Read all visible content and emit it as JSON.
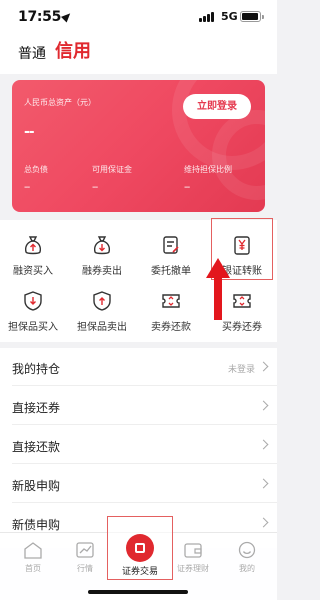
{
  "status_bar": {
    "time": "17:55",
    "network": "5G"
  },
  "header": {
    "mode_normal": "普通",
    "mode_credit": "信用"
  },
  "asset_card": {
    "title": "人民币总资产（元）",
    "total_value": "--",
    "login_button": "立即登录",
    "stats": [
      {
        "label": "总负债",
        "value": "--"
      },
      {
        "label": "可用保证金",
        "value": "--"
      },
      {
        "label": "维持担保比例",
        "value": "--"
      }
    ]
  },
  "functions": [
    {
      "label": "融资买入",
      "icon": "bag-up-arrow-icon"
    },
    {
      "label": "融券卖出",
      "icon": "bag-down-arrow-icon"
    },
    {
      "label": "委托撤单",
      "icon": "document-edit-icon"
    },
    {
      "label": "银证转账",
      "icon": "yuan-transfer-icon"
    },
    {
      "label": "担保品买入",
      "icon": "shield-down-icon"
    },
    {
      "label": "担保品卖出",
      "icon": "shield-up-icon"
    },
    {
      "label": "卖券还款",
      "icon": "ticket-icon"
    },
    {
      "label": "买券还券",
      "icon": "ticket-icon"
    }
  ],
  "list": [
    {
      "title": "我的持仓",
      "status": "未登录"
    },
    {
      "title": "直接还券",
      "status": ""
    },
    {
      "title": "直接还款",
      "status": ""
    },
    {
      "title": "新股申购",
      "status": ""
    },
    {
      "title": "新债申购",
      "status": ""
    }
  ],
  "tabs": [
    {
      "label": "首页",
      "icon": "home-icon"
    },
    {
      "label": "行情",
      "icon": "chart-icon"
    },
    {
      "label": "证券交易",
      "icon": "trade-icon"
    },
    {
      "label": "证券理财",
      "icon": "wallet-icon"
    },
    {
      "label": "我的",
      "icon": "smile-icon"
    }
  ],
  "colors": {
    "brand_red": "#e0292f",
    "card_red": "#ef4961",
    "highlight": "#e46060"
  }
}
